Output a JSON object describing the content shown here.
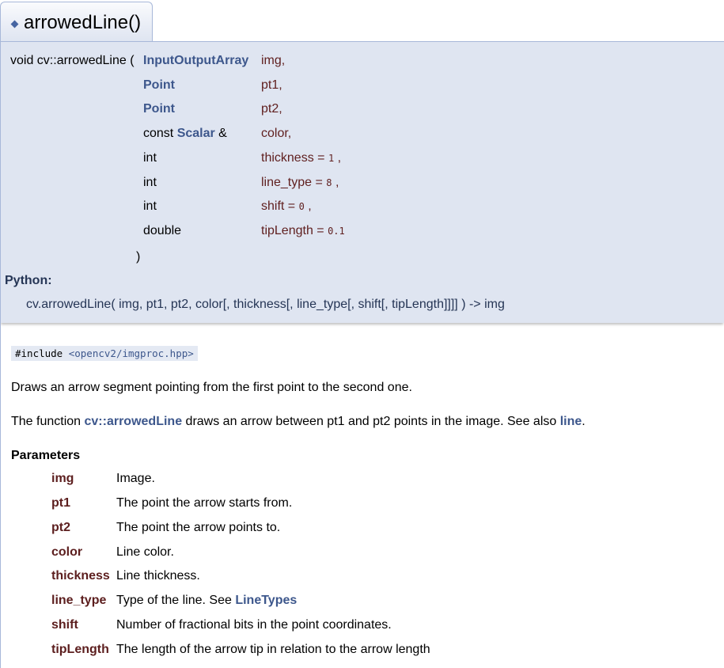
{
  "header": {
    "title": "arrowedLine()",
    "bullet_icon": "diamond-bullet-icon"
  },
  "prototype": {
    "return_and_name": "void cv::arrowedLine (",
    "params": [
      {
        "type_prefix": "",
        "type_bold": "InputOutputArray",
        "type_suffix": "",
        "name": "img,",
        "default": "",
        "tail": ""
      },
      {
        "type_prefix": "",
        "type_bold": "Point",
        "type_suffix": "",
        "name": "pt1,",
        "default": "",
        "tail": ""
      },
      {
        "type_prefix": "",
        "type_bold": "Point",
        "type_suffix": "",
        "name": "pt2,",
        "default": "",
        "tail": ""
      },
      {
        "type_prefix": "const ",
        "type_bold": "Scalar",
        "type_suffix": " &",
        "name": "color,",
        "default": "",
        "tail": ""
      },
      {
        "type_prefix": "int",
        "type_bold": "",
        "type_suffix": "",
        "name": "thickness = ",
        "default": "1",
        "tail": " ,"
      },
      {
        "type_prefix": "int",
        "type_bold": "",
        "type_suffix": "",
        "name": "line_type = ",
        "default": "8",
        "tail": " ,"
      },
      {
        "type_prefix": "int",
        "type_bold": "",
        "type_suffix": "",
        "name": "shift = ",
        "default": "0",
        "tail": " ,"
      },
      {
        "type_prefix": "double",
        "type_bold": "",
        "type_suffix": "",
        "name": "tipLength = ",
        "default": "0.1",
        "tail": ""
      }
    ],
    "close_paren": ")",
    "python_label": "Python:",
    "python_signature": "cv.arrowedLine( img, pt1, pt2, color[, thickness[, line_type[, shift[, tipLength]]]] ) -> img"
  },
  "include": {
    "prefix": "#include ",
    "file": "<opencv2/imgproc.hpp>"
  },
  "brief": "Draws an arrow segment pointing from the first point to the second one.",
  "details": {
    "before": "The function ",
    "link1": "cv::arrowedLine",
    "middle": " draws an arrow between pt1 and pt2 points in the image. See also ",
    "link2": "line",
    "after": "."
  },
  "parameters": {
    "title": "Parameters",
    "items": [
      {
        "name": "img",
        "desc": "Image.",
        "link": ""
      },
      {
        "name": "pt1",
        "desc": "The point the arrow starts from.",
        "link": ""
      },
      {
        "name": "pt2",
        "desc": "The point the arrow points to.",
        "link": ""
      },
      {
        "name": "color",
        "desc": "Line color.",
        "link": ""
      },
      {
        "name": "thickness",
        "desc": "Line thickness.",
        "link": ""
      },
      {
        "name": "line_type",
        "desc": "Type of the line. See ",
        "link": "LineTypes"
      },
      {
        "name": "shift",
        "desc": "Number of fractional bits in the point coordinates.",
        "link": ""
      },
      {
        "name": "tipLength",
        "desc": "The length of the arrow tip in relation to the arrow length",
        "link": ""
      }
    ]
  },
  "colors": {
    "accent": "#3d578c",
    "param_name": "#5c1e1e",
    "proto_bg": "#dfe5f1",
    "border": "#a8b8d9"
  }
}
